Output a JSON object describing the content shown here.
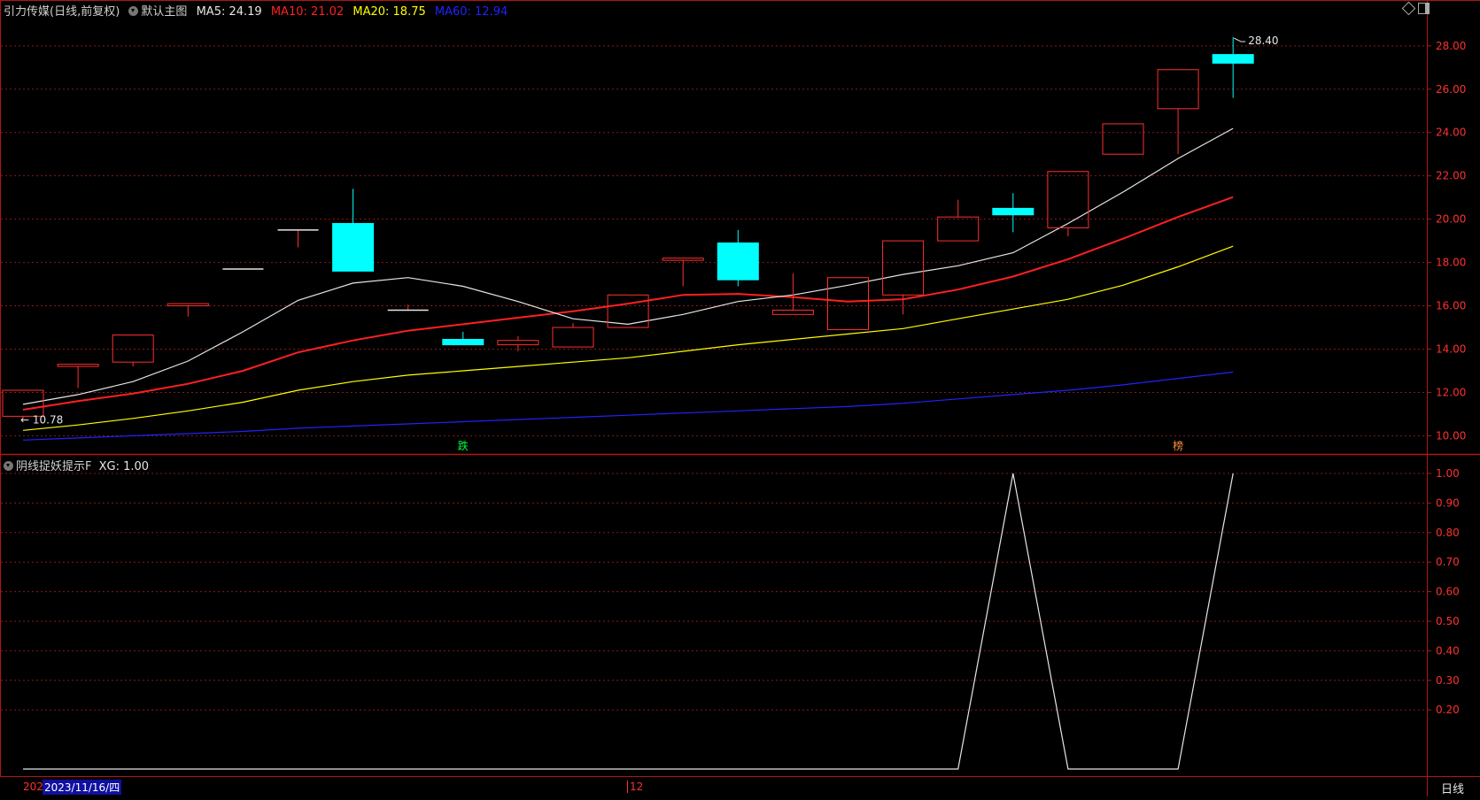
{
  "header": {
    "stock_title": "引力传媒(日线,前复权)",
    "main_chart_label": "默认主图",
    "ma_items": [
      {
        "label": "MA5: 24.19",
        "color": "#e6e6e6"
      },
      {
        "label": "MA10: 21.02",
        "color": "#ff2020"
      },
      {
        "label": "MA20: 18.75",
        "color": "#ffff00"
      },
      {
        "label": "MA60: 12.94",
        "color": "#2222ff"
      }
    ]
  },
  "indicator_header": {
    "label": "阴线捉妖提示F",
    "value_label": "XG: 1.00"
  },
  "annotations": {
    "low_marker": "← 10.78",
    "high_marker": "28.40",
    "die_marker": "跌",
    "bang_marker": "榜"
  },
  "bottom_bar": {
    "left_year": "202",
    "selected_date": "2023/11/16/四",
    "month_tick": "12",
    "period_label": "日线"
  },
  "colors": {
    "up": "#ff3030",
    "down": "#00ffff",
    "ma5": "#e6e6e6",
    "ma10": "#ff2020",
    "ma20": "#ffff00",
    "ma60": "#2222ff",
    "axis": "#b31414",
    "grid": "#8a1a1a",
    "text_axis": "#ff3030"
  },
  "chart_data": [
    {
      "type": "candlestick",
      "title": "",
      "y_axis_ticks": [
        "10.00",
        "12.00",
        "14.00",
        "16.00",
        "18.00",
        "20.00",
        "22.00",
        "24.00",
        "26.00",
        "28.00"
      ],
      "ylim": [
        9.2,
        29.3
      ],
      "candles": [
        {
          "open": 10.9,
          "close": 12.1,
          "high": 12.1,
          "low": 10.78
        },
        {
          "open": 13.2,
          "close": 13.3,
          "high": 13.3,
          "low": 12.2
        },
        {
          "open": 13.4,
          "close": 14.65,
          "high": 14.65,
          "low": 13.2
        },
        {
          "open": 16.0,
          "close": 16.1,
          "high": 16.1,
          "low": 15.5
        },
        {
          "open": 17.7,
          "close": 17.7,
          "high": 17.7,
          "low": 17.7
        },
        {
          "open": 19.5,
          "close": 19.5,
          "high": 19.5,
          "low": 18.7
        },
        {
          "open": 19.8,
          "close": 17.6,
          "high": 21.4,
          "low": 17.6
        },
        {
          "open": 15.8,
          "close": 15.8,
          "high": 16.05,
          "low": 15.8
        },
        {
          "open": 14.45,
          "close": 14.2,
          "high": 14.8,
          "low": 14.2
        },
        {
          "open": 14.2,
          "close": 14.4,
          "high": 14.6,
          "low": 13.9
        },
        {
          "open": 14.1,
          "close": 15.0,
          "high": 15.2,
          "low": 14.1
        },
        {
          "open": 15.0,
          "close": 16.5,
          "high": 16.5,
          "low": 15.0
        },
        {
          "open": 18.1,
          "close": 18.2,
          "high": 18.2,
          "low": 16.9
        },
        {
          "open": 18.9,
          "close": 17.2,
          "high": 19.5,
          "low": 16.9
        },
        {
          "open": 15.6,
          "close": 15.8,
          "high": 17.5,
          "low": 15.6
        },
        {
          "open": 14.9,
          "close": 17.3,
          "high": 17.3,
          "low": 14.9
        },
        {
          "open": 16.5,
          "close": 19.0,
          "high": 19.0,
          "low": 15.6
        },
        {
          "open": 19.0,
          "close": 20.1,
          "high": 20.9,
          "low": 19.0
        },
        {
          "open": 20.5,
          "close": 20.2,
          "high": 21.2,
          "low": 19.4
        },
        {
          "open": 19.6,
          "close": 22.2,
          "high": 22.2,
          "low": 19.2
        },
        {
          "open": 23.0,
          "close": 24.4,
          "high": 24.4,
          "low": 23.0
        },
        {
          "open": 25.1,
          "close": 26.9,
          "high": 26.9,
          "low": 23.0
        },
        {
          "open": 27.6,
          "close": 27.2,
          "high": 28.4,
          "low": 25.6
        }
      ],
      "ma5": [
        11.45,
        11.9,
        12.5,
        13.45,
        14.8,
        16.25,
        17.05,
        17.3,
        16.9,
        16.2,
        15.4,
        15.15,
        15.6,
        16.2,
        16.5,
        16.95,
        17.45,
        17.85,
        18.45,
        19.8,
        21.25,
        22.8,
        24.19
      ],
      "ma10": [
        11.2,
        11.6,
        11.95,
        12.4,
        13.0,
        13.85,
        14.4,
        14.85,
        15.15,
        15.45,
        15.75,
        16.1,
        16.5,
        16.55,
        16.4,
        16.2,
        16.3,
        16.75,
        17.35,
        18.15,
        19.1,
        20.1,
        21.02
      ],
      "ma20": [
        10.25,
        10.5,
        10.8,
        11.15,
        11.55,
        12.1,
        12.5,
        12.8,
        13.0,
        13.2,
        13.4,
        13.6,
        13.9,
        14.2,
        14.45,
        14.7,
        14.95,
        15.4,
        15.85,
        16.3,
        16.95,
        17.8,
        18.75
      ],
      "ma60": [
        9.8,
        9.9,
        10.0,
        10.1,
        10.2,
        10.35,
        10.45,
        10.55,
        10.65,
        10.75,
        10.85,
        10.95,
        11.05,
        11.15,
        11.25,
        11.35,
        11.5,
        11.7,
        11.9,
        12.1,
        12.35,
        12.65,
        12.94
      ]
    },
    {
      "type": "line",
      "title": "",
      "name": "XG",
      "y_axis_ticks": [
        "0.20",
        "0.30",
        "0.40",
        "0.50",
        "0.60",
        "0.70",
        "0.80",
        "0.90",
        "1.00"
      ],
      "ylim": [
        0.0,
        1.0
      ],
      "values": [
        0,
        0,
        0,
        0,
        0,
        0,
        0,
        0,
        0,
        0,
        0,
        0,
        0,
        0,
        0,
        0,
        0,
        0,
        1,
        0,
        0,
        0,
        1
      ]
    }
  ]
}
